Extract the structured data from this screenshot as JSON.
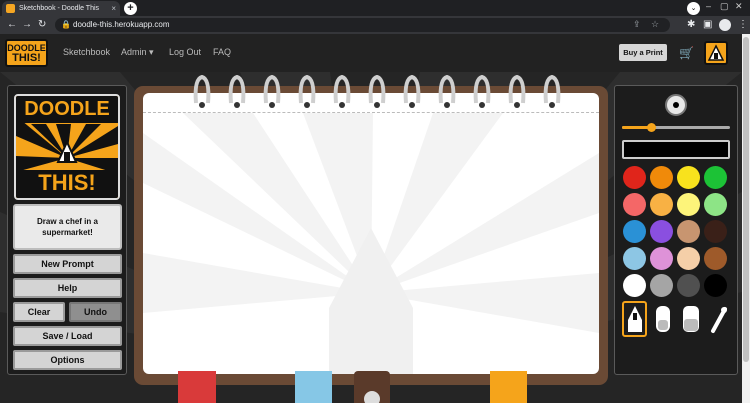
{
  "browser": {
    "tab_title": "Sketchbook - Doodle This",
    "url": "doodle-this.herokuapp.com",
    "close_glyph": "×",
    "newtab_glyph": "+",
    "back_glyph": "←",
    "forward_glyph": "→",
    "reload_glyph": "↻",
    "lock_glyph": "🔒",
    "share_glyph": "⇪",
    "star_glyph": "☆",
    "extensions_glyph": "✱",
    "sidepanel_glyph": "▣",
    "menu_glyph": "⋮",
    "tabsearch_glyph": "⌄",
    "minimize_glyph": "–",
    "maximize_glyph": "▢",
    "window_close_glyph": "✕"
  },
  "nav": {
    "brand_line1": "DOODLE",
    "brand_line2": "THIS!",
    "links": [
      "Sketchbook",
      "Admin ▾",
      "Log Out",
      "FAQ"
    ],
    "buy_print": "Buy a Print",
    "cart_glyph": "🛒"
  },
  "left_panel": {
    "logo_line1": "DOODLE",
    "logo_line2": "THIS!",
    "prompt": "Draw a chef in a supermarket!",
    "buttons": {
      "new_prompt": "New Prompt",
      "help": "Help",
      "clear": "Clear",
      "undo": "Undo",
      "save_load": "Save / Load",
      "options": "Options"
    }
  },
  "right_panel": {
    "brush_size_level": 0.27,
    "current_color": "#000000",
    "palette": [
      "#e0251b",
      "#f08a0a",
      "#f8e21d",
      "#1cc236",
      "#f46767",
      "#f8b144",
      "#fdf47a",
      "#8de486",
      "#2a91d6",
      "#8a4fe0",
      "#c89570",
      "#3a2018",
      "#8dc6e4",
      "#de92d8",
      "#f5cfa8",
      "#9e5a2a",
      "#ffffff",
      "#a5a5a5",
      "#505050",
      "#000000"
    ],
    "tools": [
      "pencil-icon",
      "eraser-icon",
      "eraser-icon",
      "eyedropper-icon"
    ],
    "selected_tool": "pencil-icon"
  },
  "colors": {
    "accent": "#f5a41b",
    "frame": "#6a4a35",
    "tab_red": "#d93a3a",
    "tab_blue": "#86c7e6",
    "tab_brown": "#5a3a2a",
    "tab_orange": "#f5a41b"
  }
}
